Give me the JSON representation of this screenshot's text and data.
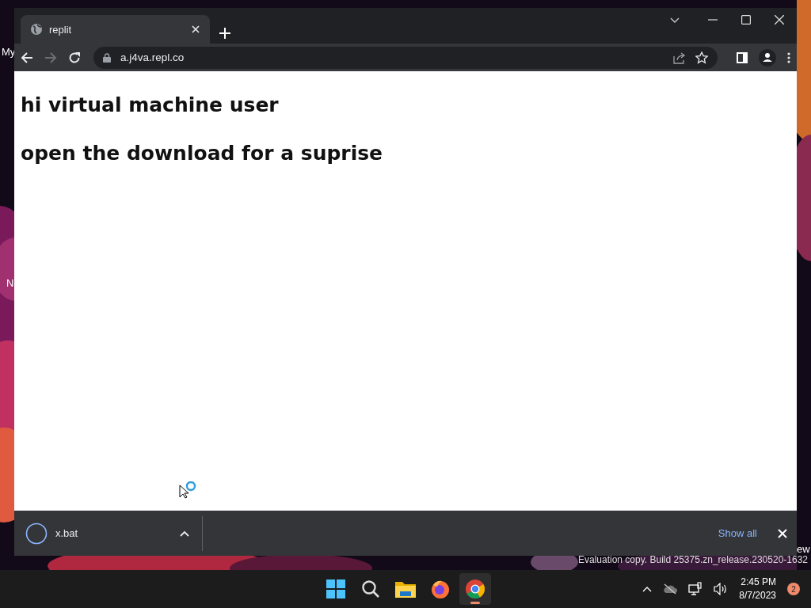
{
  "desktop": {
    "labels": [
      "My",
      "N",
      "ew"
    ],
    "watermark": "Evaluation copy. Build 25375.zn_release.230520-1632"
  },
  "browser": {
    "tabs": [
      {
        "title": "replit",
        "selected": true
      }
    ],
    "address": "a.j4va.repl.co",
    "forward_disabled": true,
    "page": {
      "lines": [
        "hi virtual machine user",
        "open the download for a suprise"
      ]
    },
    "downloads": {
      "items": [
        {
          "name": "x.bat"
        }
      ],
      "show_all": "Show all"
    }
  },
  "taskbar": {
    "apps": [
      {
        "kind": "start",
        "selected": false
      },
      {
        "kind": "search",
        "selected": false
      },
      {
        "kind": "files",
        "selected": false
      },
      {
        "kind": "firefox",
        "selected": false
      },
      {
        "kind": "chrome",
        "selected": true
      }
    ],
    "time": "2:45 PM",
    "date": "8/7/2023",
    "notifications": "2"
  }
}
